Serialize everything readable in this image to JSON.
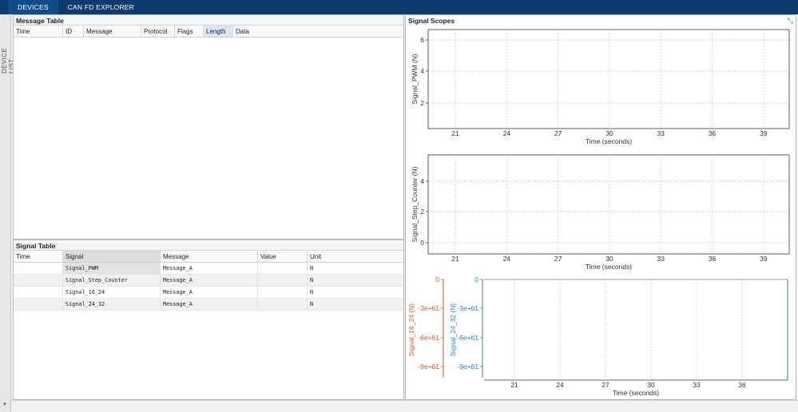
{
  "tabs": [
    {
      "label": "DEVICES"
    },
    {
      "label": "CAN FD EXPLORER"
    }
  ],
  "side": {
    "label": "DEVICE LIST",
    "expand_glyph": "⯈"
  },
  "message_table": {
    "title": "Message Table",
    "columns": [
      "Time",
      "ID",
      "Message",
      "Protocol",
      "Flags",
      "Length",
      "Data"
    ]
  },
  "signal_table": {
    "title": "Signal Table",
    "columns": [
      "Time",
      "Signal",
      "Value",
      "Unit"
    ],
    "message_col": "Message",
    "rows": [
      {
        "time": "",
        "signal": "Signal_PWM",
        "message": "Message_A",
        "value": "",
        "unit": "N"
      },
      {
        "time": "",
        "signal": "Signal_Step_Counter",
        "message": "Message_A",
        "value": "",
        "unit": "N"
      },
      {
        "time": "",
        "signal": "Signal_16_24",
        "message": "Message_A",
        "value": "",
        "unit": "N"
      },
      {
        "time": "",
        "signal": "Signal_24_32",
        "message": "Message_A",
        "value": "",
        "unit": "N"
      }
    ]
  },
  "scopes": {
    "title": "Signal Scopes",
    "icon": "collapse-arrows-icon",
    "xlabel": "Time (seconds)",
    "plot1": {
      "ylabel": "Signal_PWM (N)",
      "yticks": [
        "2",
        "4",
        "6"
      ],
      "xticks": [
        "21",
        "24",
        "27",
        "30",
        "33",
        "36",
        "39"
      ]
    },
    "plot2": {
      "ylabel": "Signal_Step_Counter (N)",
      "yticks": [
        "0",
        "2",
        "4"
      ],
      "xticks": [
        "21",
        "24",
        "27",
        "30",
        "33",
        "36",
        "39"
      ]
    },
    "plot3": {
      "ylabel_left": "Signal_16_24 (N)",
      "ylabel_right": "Signal_24_32 (N)",
      "yticks_left": [
        "0",
        "-3e+61",
        "-6e+61",
        "-9e+61"
      ],
      "yticks_right": [
        "0",
        "-3e+61",
        "-6e+61",
        "-9e+61"
      ],
      "xticks": [
        "21",
        "24",
        "27",
        "30",
        "33",
        "36"
      ],
      "left_color": "#e0531f",
      "right_color": "#1f7fc8"
    }
  }
}
